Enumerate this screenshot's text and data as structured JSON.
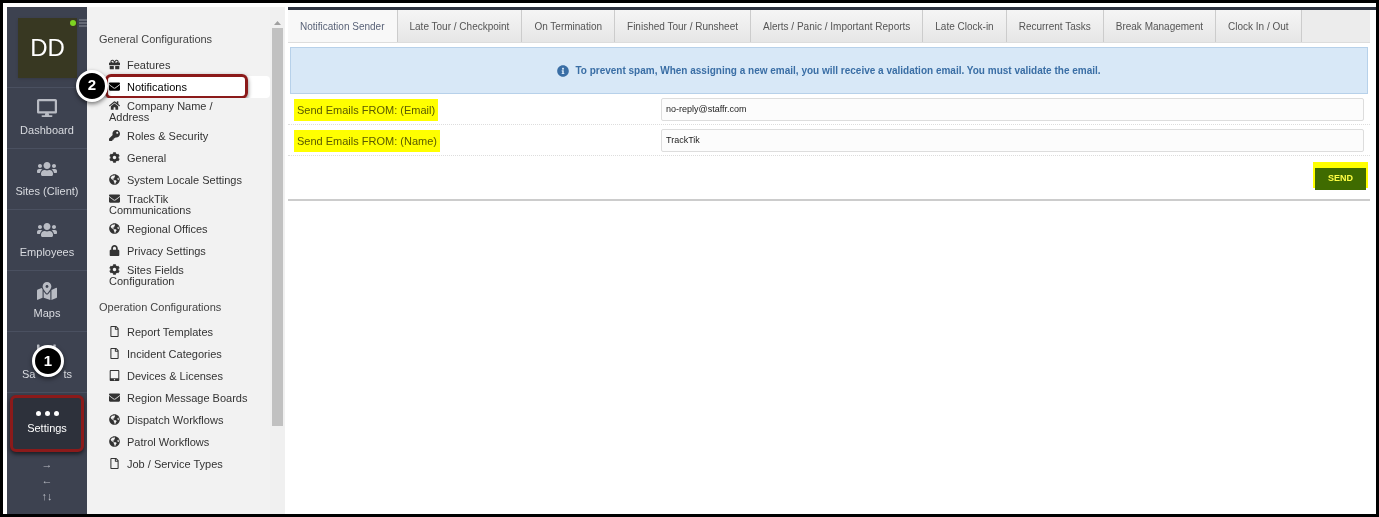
{
  "avatar": {
    "initials": "DD",
    "online": true
  },
  "nav": [
    {
      "kind": "dashboard",
      "label": "Dashboard",
      "selected": false
    },
    {
      "kind": "sites",
      "label": "Sites (Client)",
      "selected": false
    },
    {
      "kind": "employees",
      "label": "Employees",
      "selected": false
    },
    {
      "kind": "maps",
      "label": "Maps",
      "selected": false
    },
    {
      "kind": "reports",
      "label": "Sa",
      "label_end": "ts",
      "selected": false,
      "callout": "1"
    },
    {
      "kind": "settings",
      "label": "Settings",
      "selected": true
    }
  ],
  "nav_arrows": [
    "→",
    "←",
    "↑↓"
  ],
  "settings_menu": [
    {
      "heading": "General Configurations",
      "items": [
        {
          "kind": "gift",
          "label": "Features",
          "selected": false
        },
        {
          "kind": "envelope",
          "label": "Notifications",
          "selected": true,
          "callout": "2"
        },
        {
          "kind": "home",
          "label": "Company Name / Address",
          "selected": false
        },
        {
          "kind": "key",
          "label": "Roles & Security",
          "selected": false
        },
        {
          "kind": "gear",
          "label": "General",
          "selected": false
        },
        {
          "kind": "globe",
          "label": "System Locale Settings",
          "selected": false
        },
        {
          "kind": "envelope",
          "label": "TrackTik Communications",
          "selected": false
        },
        {
          "kind": "globe",
          "label": "Regional Offices",
          "selected": false
        },
        {
          "kind": "lock",
          "label": "Privacy Settings",
          "selected": false
        },
        {
          "kind": "gear",
          "label": "Sites Fields Configuration",
          "selected": false
        }
      ]
    },
    {
      "heading": "Operation Configurations",
      "items": [
        {
          "kind": "file",
          "label": "Report Templates",
          "selected": false
        },
        {
          "kind": "file",
          "label": "Incident Categories",
          "selected": false
        },
        {
          "kind": "tablet",
          "label": "Devices & Licenses",
          "selected": false
        },
        {
          "kind": "envelope",
          "label": "Region Message Boards",
          "selected": false
        },
        {
          "kind": "globe",
          "label": "Dispatch Workflows",
          "selected": false
        },
        {
          "kind": "globe",
          "label": "Patrol Workflows",
          "selected": false
        },
        {
          "kind": "file",
          "label": "Job / Service Types",
          "selected": false
        }
      ]
    }
  ],
  "tabs": [
    {
      "label": "Notification Sender",
      "selected": true
    },
    {
      "label": "Late Tour / Checkpoint",
      "selected": false
    },
    {
      "label": "On Termination",
      "selected": false
    },
    {
      "label": "Finished Tour / Runsheet",
      "selected": false
    },
    {
      "label": "Alerts / Panic / Important Reports",
      "selected": false
    },
    {
      "label": "Late Clock-in",
      "selected": false
    },
    {
      "label": "Recurrent Tasks",
      "selected": false
    },
    {
      "label": "Break Management",
      "selected": false
    },
    {
      "label": "Clock In / Out",
      "selected": false
    }
  ],
  "info_message": "To prevent spam, When assigning a new email, you will receive a validation email. You must validate the email.",
  "form": [
    {
      "label": "Send Emails FROM: (Email)",
      "value": "no-reply@staffr.com",
      "highlighted": true
    },
    {
      "label": "Send Emails FROM: (Name)",
      "value": "TrackTik",
      "highlighted": true
    }
  ],
  "send_button": {
    "label": "SEND",
    "highlighted": true
  }
}
